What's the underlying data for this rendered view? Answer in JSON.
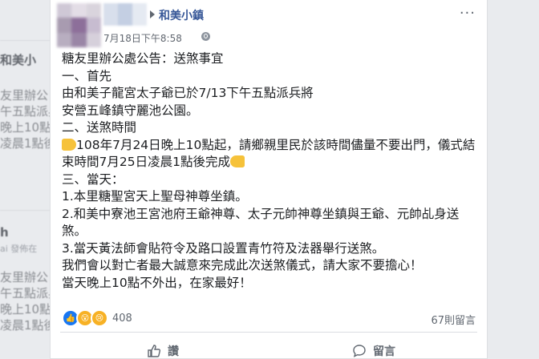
{
  "background_feed": {
    "lines": [
      "和美小",
      "友里辦公",
      "午五點派兵",
      "晚上10點",
      "凌晨1點後",
      "h",
      "ai 發佈在",
      "友里辦公",
      "午五點派兵",
      "晚上10點",
      "凌晨1點後"
    ]
  },
  "post": {
    "page_name": "和美小鎮",
    "timestamp": "7月18日下午8:58",
    "lines": [
      "糖友里辦公處公告：送煞事宜",
      "一、首先",
      "由和美子龍宮太子爺已於7/13下午五點派兵將",
      "安營五峰鎮守麗池公園。",
      "二、送煞時間",
      "108年7月24日晚上10點起，請鄉親里民於該時間儘量不要出門，儀式結束時間7月25日凌晨1點後完成",
      "三、當天：",
      "1.本里糖聖宮天上聖母神尊坐鎮。",
      "2.和美中寮池王宮池府王爺神尊、太子元帥神尊坐鎮與王爺、元帥乩身送煞。",
      "3.當天黃法師會貼符令及路口設置青竹符及法器舉行送煞。",
      "我們會以對亡者最大誠意來完成此次送煞儀式，請大家不要擔心！",
      "當天晚上10點不外出，在家最好！"
    ],
    "reaction_count": "408",
    "comment_count": "67則留言",
    "actions": {
      "like": "讚",
      "comment": "留言"
    }
  }
}
